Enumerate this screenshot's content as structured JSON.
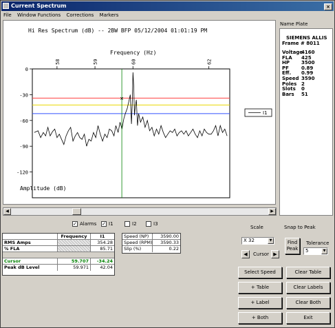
{
  "window": {
    "title": "Current Spectrum"
  },
  "menu": [
    "File",
    "Window Functions",
    "Corrections",
    "Markers"
  ],
  "chart": {
    "title": "Hi Res Spectrum (dB) -- 2BW BFP  05/12/2004 01:01:19 PM",
    "top_label": "Frequency (Hz)",
    "left_label": "Amplitude (dB)",
    "legend_series": "I1",
    "colors": {
      "trace": "#000000",
      "alarm_red": "#ff4040",
      "alarm_yellow": "#e8d800",
      "alarm_blue": "#3050ff",
      "cursor": "#008000"
    }
  },
  "chart_data": {
    "type": "line",
    "title": "Hi Res Spectrum (dB) -- 2BW BFP  05/12/2004 01:01:19 PM",
    "xlabel": "Frequency (Hz)",
    "ylabel": "Amplitude (dB)",
    "x_ticks": [
      58,
      59,
      60,
      62
    ],
    "y_ticks": [
      0,
      -30,
      -60,
      -90,
      -120
    ],
    "xlim": [
      57.35,
      62.55
    ],
    "ylim": [
      -150,
      0
    ],
    "series": [
      {
        "name": "I1",
        "x": [
          57.4,
          57.5,
          57.57,
          57.64,
          57.7,
          57.76,
          57.82,
          57.88,
          57.94,
          58.0,
          58.06,
          58.12,
          58.18,
          58.24,
          58.3,
          58.36,
          58.42,
          58.48,
          58.54,
          58.6,
          58.66,
          58.72,
          58.78,
          58.84,
          58.9,
          58.96,
          59.02,
          59.08,
          59.14,
          59.2,
          59.26,
          59.32,
          59.38,
          59.44,
          59.5,
          59.55,
          59.61,
          59.66,
          59.71,
          59.76,
          59.8,
          59.85,
          59.89,
          59.93,
          59.96,
          59.98,
          60.0,
          60.02,
          60.04,
          60.06,
          60.09,
          60.12,
          60.15,
          60.2,
          60.26,
          60.32,
          60.38,
          60.44,
          60.5,
          60.56,
          60.62,
          60.68,
          60.74,
          60.8,
          60.86,
          60.92,
          60.98,
          61.04,
          61.1,
          61.16,
          61.22,
          61.28,
          61.34,
          61.4,
          61.46,
          61.52,
          61.58,
          61.64,
          61.7,
          61.76,
          61.82,
          61.88,
          61.94,
          62.0,
          62.06,
          62.12,
          62.18,
          62.24,
          62.3,
          62.36,
          62.42,
          62.48
        ],
        "y": [
          -74,
          -72,
          -80,
          -74,
          -78,
          -68,
          -78,
          -73,
          -70,
          -80,
          -76,
          -82,
          -88,
          -78,
          -72,
          -68,
          -84,
          -78,
          -74,
          -80,
          -82,
          -76,
          -90,
          -82,
          -84,
          -74,
          -80,
          -66,
          -76,
          -84,
          -76,
          -80,
          -70,
          -72,
          -78,
          -66,
          -74,
          -62,
          -70,
          -58,
          -52,
          -46,
          -38,
          -30,
          -64,
          -42,
          -4,
          -20,
          -54,
          -44,
          -36,
          -66,
          -52,
          -62,
          -56,
          -68,
          -60,
          -72,
          -68,
          -78,
          -70,
          -76,
          -66,
          -74,
          -80,
          -76,
          -72,
          -74,
          -70,
          -78,
          -74,
          -72,
          -76,
          -72,
          -78,
          -74,
          -70,
          -76,
          -80,
          -72,
          -78,
          -70,
          -74,
          -76,
          -76,
          -72,
          -66,
          -78,
          -66,
          -74,
          -70,
          -78
        ]
      }
    ],
    "reference_lines": [
      -34,
      -42,
      -52
    ],
    "cursor_x": 59.707,
    "cursor_y": -34.24
  },
  "nameplate": {
    "label": "Name Plate",
    "maker": "SIEMENS ALLIS",
    "frame": "Frame # 8011",
    "rows": [
      {
        "k": "Voltage",
        "v": "4160"
      },
      {
        "k": "FLA",
        "v": "425"
      },
      {
        "k": "HP",
        "v": "3500"
      },
      {
        "k": "PF",
        "v": "0.89"
      },
      {
        "k": "Eff.",
        "v": "0.99"
      },
      {
        "k": "Speed",
        "v": "3590"
      },
      {
        "k": "Poles",
        "v": "2"
      },
      {
        "k": "Slots",
        "v": "0"
      },
      {
        "k": "Bars",
        "v": "51"
      }
    ]
  },
  "checkboxes": [
    {
      "label": "Alarms",
      "checked": "✓"
    },
    {
      "label": "I1",
      "checked": "✓"
    },
    {
      "label": "I2",
      "checked": ""
    },
    {
      "label": "I3",
      "checked": ""
    }
  ],
  "table": {
    "headers": [
      "",
      "Frequency",
      "I1"
    ],
    "rms_label": "RMS Amps",
    "rms_i1": "354.28",
    "fla_label": "% FLA",
    "fla_i1": "85.71",
    "cursor_label": "Cursor",
    "cursor_freq": "59.707",
    "cursor_i1": "-34.24",
    "peak_label": "Peak dB Level",
    "peak_freq": "59.971",
    "peak_i1": "42.04"
  },
  "speed_table": {
    "np_label": "Speed (NP)",
    "np_value": "3590.00",
    "rpm_label": "Speed (RPM)",
    "rpm_value": "3590.33",
    "slip_label": "Slip (%)",
    "slip_value": "0.22"
  },
  "controls": {
    "scale_label": "Scale",
    "scale_value": "X 32",
    "cursor_label": "Cursor",
    "snap_label": "Snap to Peak",
    "find_peak": "Find Peak",
    "tolerance_label": "Tolerance",
    "tolerance_value": "5"
  },
  "buttons": {
    "select_speed": "Select Speed",
    "clear_table": "Clear Table",
    "add_table": "+ Table",
    "clear_labels": "Clear Labels",
    "add_label": "+ Label",
    "clear_both": "Clear Both",
    "add_both": "+ Both",
    "exit": "Exit"
  }
}
